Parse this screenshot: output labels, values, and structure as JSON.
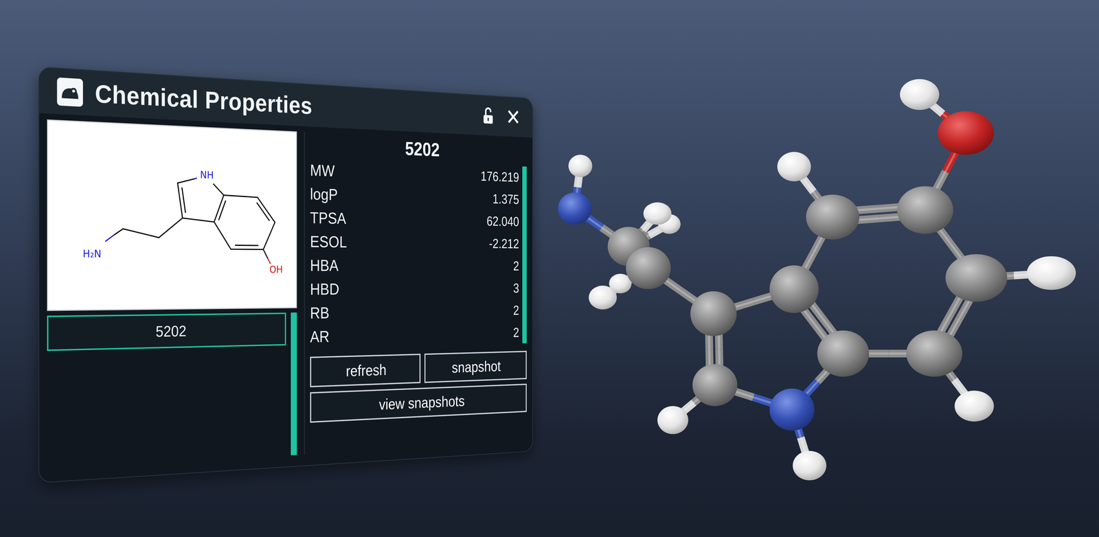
{
  "window": {
    "title": "Chemical Properties",
    "locked": false,
    "close": "✕"
  },
  "structure": {
    "labels": [
      {
        "text": "NH",
        "color": "#1f1fd6"
      },
      {
        "text": "H₂N",
        "color": "#1f1fd6"
      },
      {
        "text": "OH",
        "color": "#e01414"
      }
    ]
  },
  "compounds": [
    {
      "label": "5202",
      "selected": true
    }
  ],
  "details": {
    "id": "5202",
    "properties": [
      {
        "name": "MW",
        "value": "176.219"
      },
      {
        "name": "logP",
        "value": "1.375"
      },
      {
        "name": "TPSA",
        "value": "62.040"
      },
      {
        "name": "ESOL",
        "value": "-2.212"
      },
      {
        "name": "HBA",
        "value": "2"
      },
      {
        "name": "HBD",
        "value": "3"
      },
      {
        "name": "RB",
        "value": "2"
      },
      {
        "name": "AR",
        "value": "2"
      }
    ]
  },
  "buttons": [
    {
      "label": "refresh"
    },
    {
      "label": "snapshot"
    },
    {
      "label": "view snapshots"
    }
  ]
}
